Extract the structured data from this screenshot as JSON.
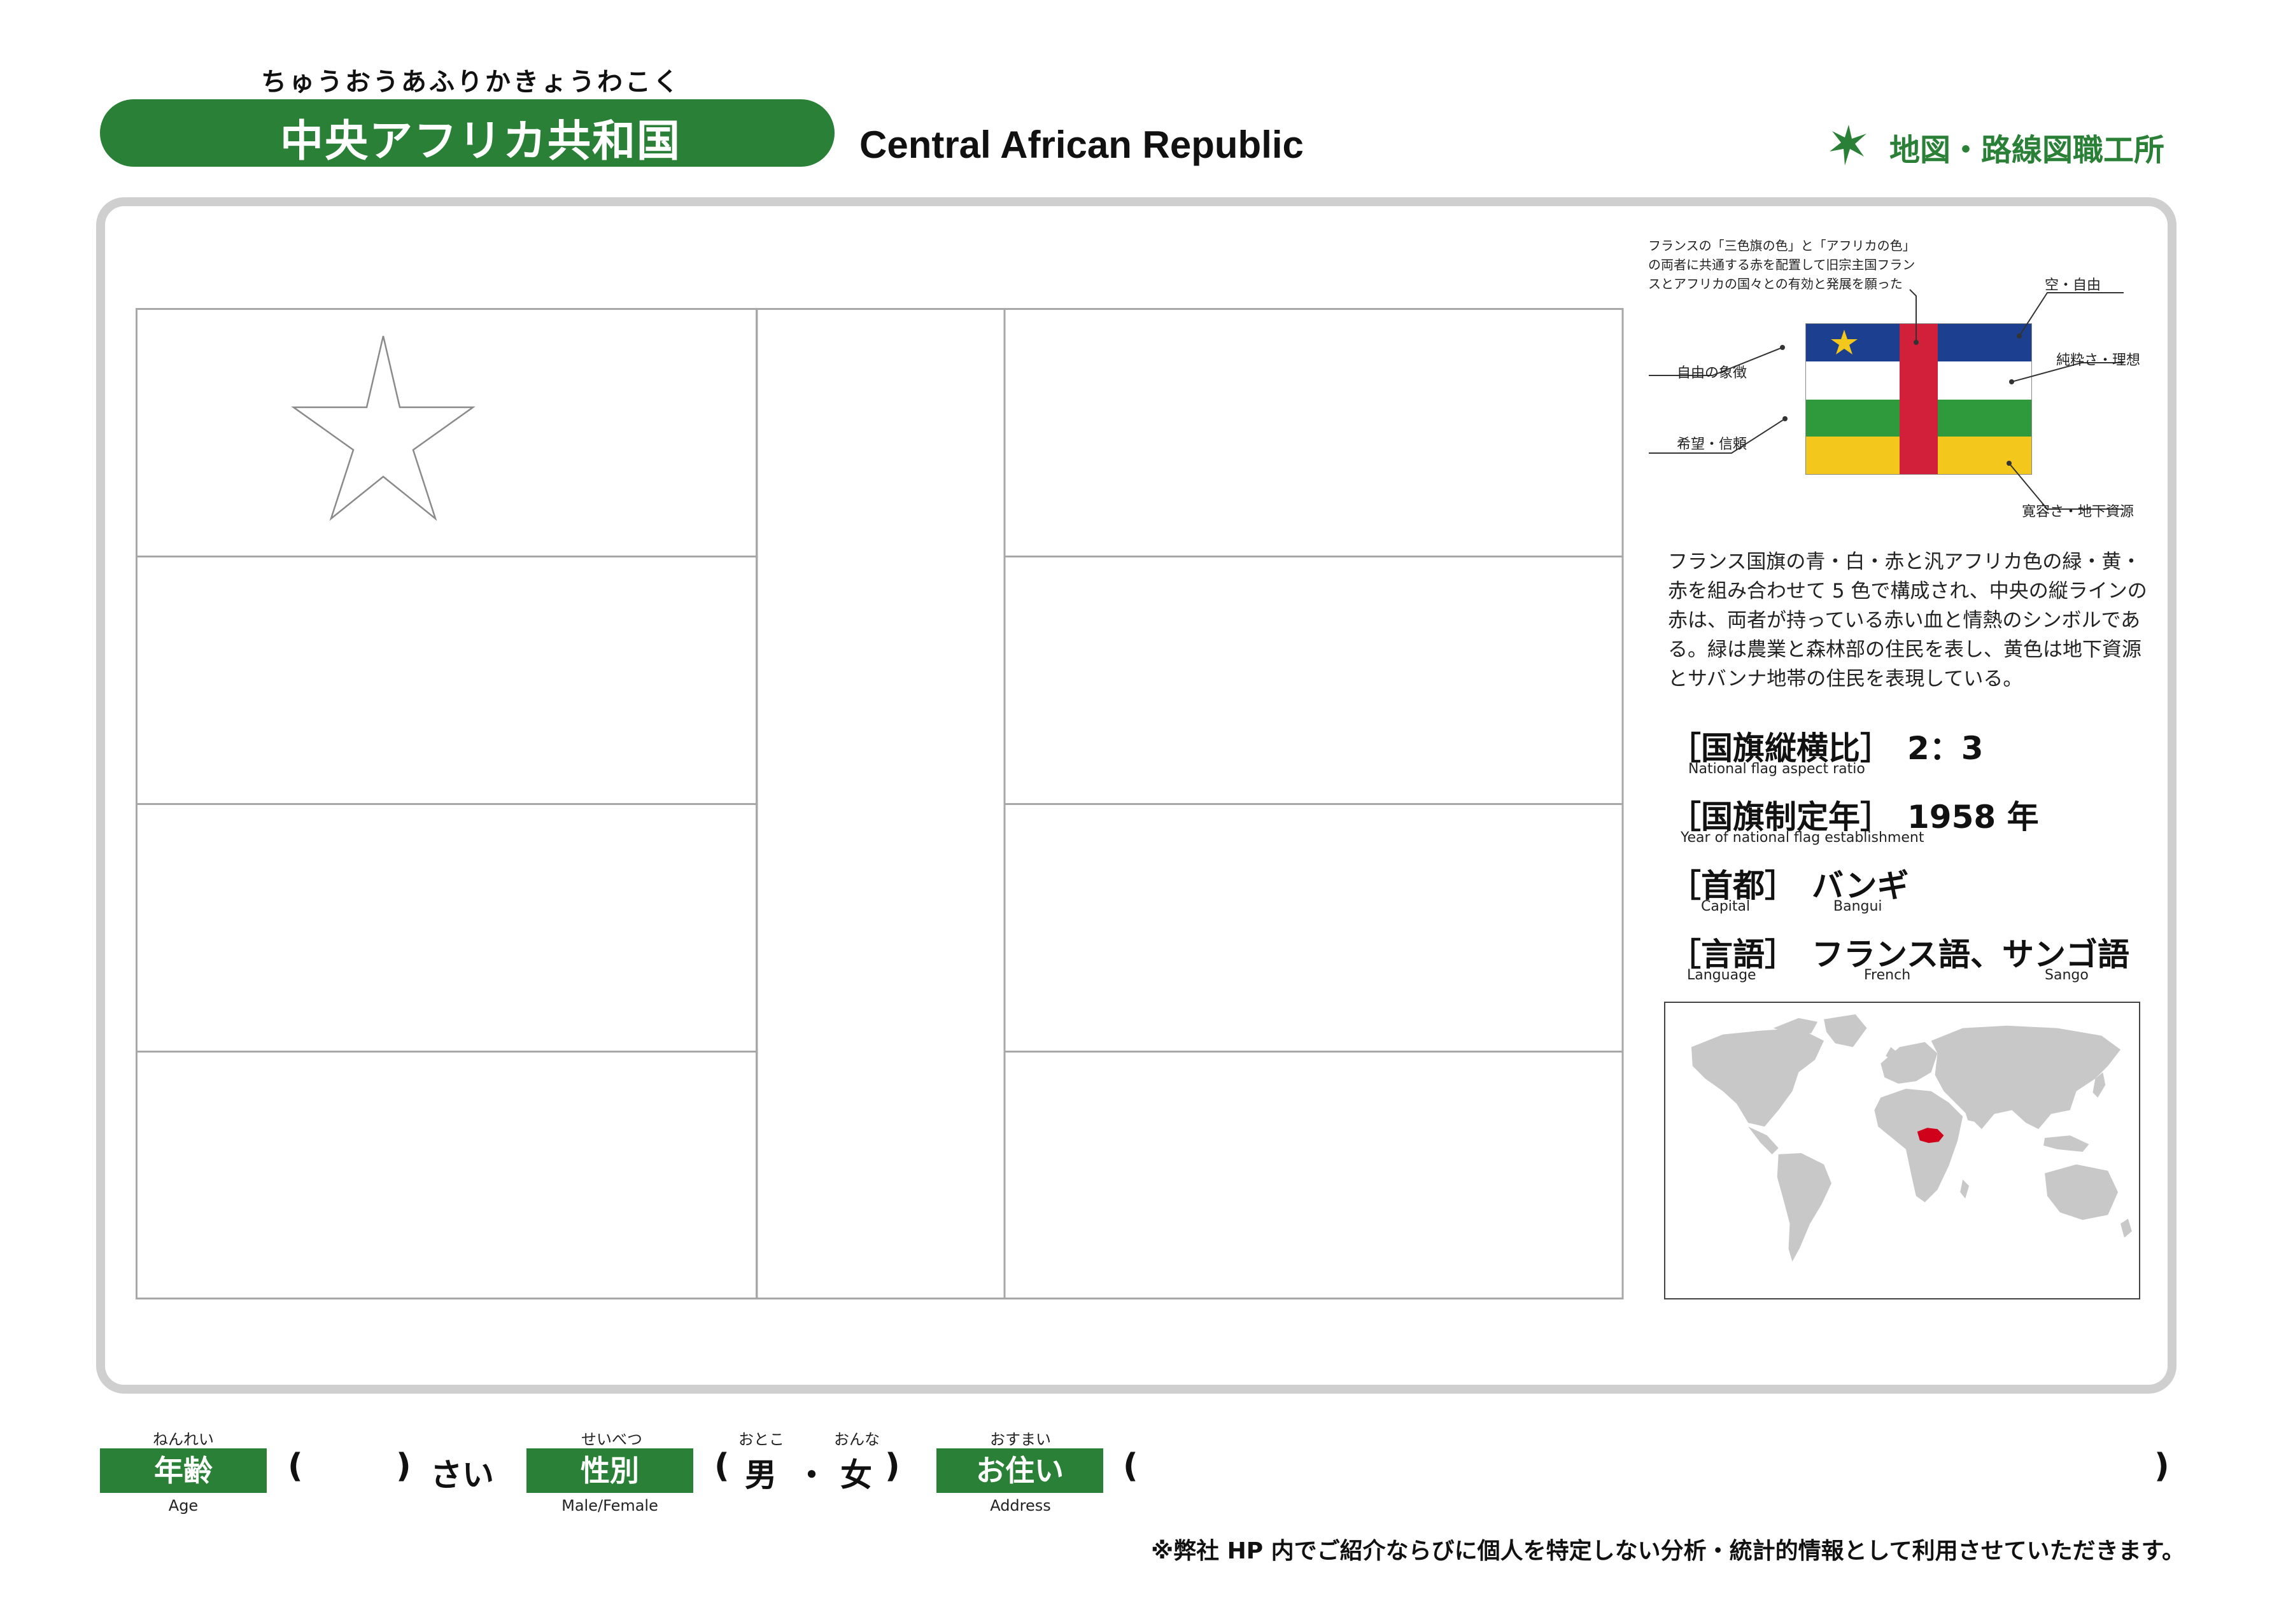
{
  "header": {
    "furigana": "ちゅうおうあふりかきょうわこく",
    "title_jp": "中央アフリカ共和国",
    "title_en": "Central African Republic",
    "logo_text": "地図・路線図職工所",
    "logo_icon": "sprout-star-icon"
  },
  "colors": {
    "brand_green": "#2a8037",
    "flag_blue": "#1c3f8f",
    "flag_white": "#ffffff",
    "flag_green": "#2e9a3c",
    "flag_yellow": "#f3c71c",
    "flag_red": "#d2203a",
    "star_yellow": "#f3c71c",
    "map_land": "#c8c8c8",
    "map_highlight": "#d0021b"
  },
  "flag_annotations": {
    "heritage": "フランスの「三色旗の色」と「アフリカの色」の両者に共通する赤を配置して旧宗主国フランスとアフリカの国々との有効と発展を願った",
    "blue": "空・自由",
    "white": "純粋さ・理想",
    "star": "自由の象徴",
    "green": "希望・信頼",
    "yellow": "寛容さ・地下資源"
  },
  "description": "フランス国旗の青・白・赤と汎アフリカ色の緑・黄・赤を組み合わせて 5 色で構成され、中央の縦ラインの赤は、両者が持っている赤い血と情熱のシンボルである。緑は農業と森林部の住民を表し、黄色は地下資源とサバンナ地帯の住民を表現している。",
  "facts": {
    "aspect_ratio": {
      "label": "国旗縦横比",
      "label_en": "National flag aspect ratio",
      "value": "2：3"
    },
    "year": {
      "label": "国旗制定年",
      "label_en": "Year of national flag establishment",
      "value": "1958 年"
    },
    "capital": {
      "label": "首都",
      "label_en": "Capital",
      "value": "バンギ",
      "value_en": "Bangui"
    },
    "language": {
      "label": "言語",
      "label_en": "Language",
      "value": "フランス語、サンゴ語",
      "value_en_1": "French",
      "value_en_2": "Sango"
    }
  },
  "brackets": {
    "open": "［",
    "close": "］"
  },
  "form": {
    "age": {
      "furigana": "ねんれい",
      "label": "年齢",
      "sub": "Age",
      "suffix": "さい"
    },
    "sex": {
      "furigana": "せいべつ",
      "label": "性別",
      "sub": "Male/Female",
      "male_furi": "おとこ",
      "female_furi": "おんな",
      "male": "男",
      "dot": "・",
      "female": "女"
    },
    "address": {
      "furigana": "おすまい",
      "label": "お住い",
      "sub": "Address"
    },
    "paren_open": "(",
    "paren_close": ")"
  },
  "notice": "※弊社 HP 内でご紹介ならびに個人を特定しない分析・統計的情報として利用させていただきます。"
}
